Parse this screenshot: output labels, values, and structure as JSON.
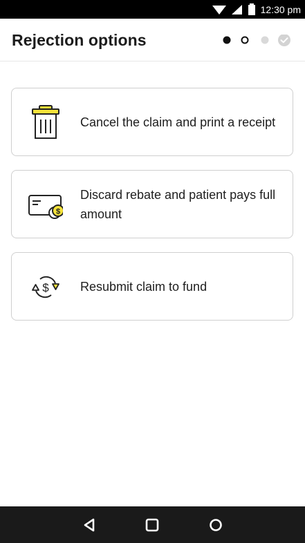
{
  "status_bar": {
    "time": "12:30 pm"
  },
  "header": {
    "title": "Rejection options"
  },
  "stepper": {
    "steps": [
      "done",
      "current",
      "upcoming",
      "complete"
    ]
  },
  "options": [
    {
      "label": "Cancel the claim and print a receipt",
      "icon": "trash-icon"
    },
    {
      "label": "Discard rebate and patient pays full amount",
      "icon": "card-dollar-icon"
    },
    {
      "label": "Resubmit claim to fund",
      "icon": "resubmit-dollar-icon"
    }
  ],
  "nav": {
    "buttons": [
      "back-icon",
      "home-icon",
      "recents-icon"
    ]
  },
  "colors": {
    "accent": "#f5e23a",
    "text": "#1e1e1e",
    "border": "#cfcfcf"
  }
}
